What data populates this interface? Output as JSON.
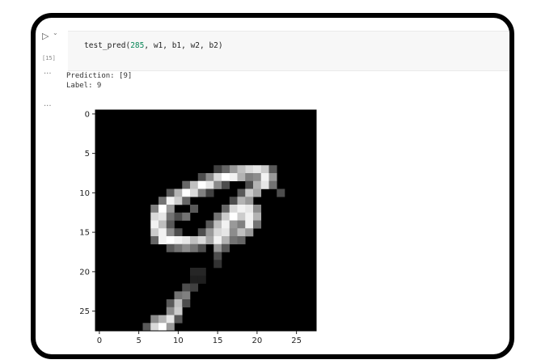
{
  "cell": {
    "run_icon": "▷",
    "caret_icon": "⌄",
    "execution_count": "[15]",
    "code_prefix": "test_pred(",
    "code_arg_number": "285",
    "code_suffix": ", w1, b1, w2, b2)"
  },
  "output": {
    "more_icon_1": "···",
    "prediction_line": "Prediction:  [9]",
    "label_line": "Label:  9",
    "more_icon_2": "···"
  },
  "chart_data": {
    "type": "heatmap",
    "title": "",
    "xlabel": "",
    "ylabel": "",
    "xticks": [
      "0",
      "5",
      "10",
      "15",
      "20",
      "25"
    ],
    "yticks": [
      "0",
      "5",
      "10",
      "15",
      "20",
      "25"
    ],
    "xlim": [
      -0.5,
      27.5
    ],
    "ylim": [
      27.5,
      -0.5
    ],
    "colormap": "gray",
    "grid": false,
    "pixels": [
      {
        "r": 7,
        "c": 19,
        "v": 0.85
      },
      {
        "r": 7,
        "c": 20,
        "v": 0.9
      },
      {
        "r": 7,
        "c": 21,
        "v": 0.8
      },
      {
        "r": 7,
        "c": 17,
        "v": 0.6
      },
      {
        "r": 7,
        "c": 18,
        "v": 0.75
      },
      {
        "r": 7,
        "c": 16,
        "v": 0.4
      },
      {
        "r": 7,
        "c": 15,
        "v": 0.25
      },
      {
        "r": 7,
        "c": 22,
        "v": 0.35
      },
      {
        "r": 8,
        "c": 13,
        "v": 0.3
      },
      {
        "r": 8,
        "c": 14,
        "v": 0.55
      },
      {
        "r": 8,
        "c": 15,
        "v": 0.85
      },
      {
        "r": 8,
        "c": 16,
        "v": 1.0
      },
      {
        "r": 8,
        "c": 17,
        "v": 0.95
      },
      {
        "r": 8,
        "c": 18,
        "v": 0.7
      },
      {
        "r": 8,
        "c": 19,
        "v": 0.5
      },
      {
        "r": 8,
        "c": 20,
        "v": 0.55
      },
      {
        "r": 8,
        "c": 21,
        "v": 0.95
      },
      {
        "r": 8,
        "c": 22,
        "v": 0.6
      },
      {
        "r": 9,
        "c": 11,
        "v": 0.4
      },
      {
        "r": 9,
        "c": 12,
        "v": 0.75
      },
      {
        "r": 9,
        "c": 13,
        "v": 1.0
      },
      {
        "r": 9,
        "c": 14,
        "v": 0.9
      },
      {
        "r": 9,
        "c": 15,
        "v": 0.55
      },
      {
        "r": 9,
        "c": 16,
        "v": 0.3
      },
      {
        "r": 9,
        "c": 19,
        "v": 0.3
      },
      {
        "r": 9,
        "c": 20,
        "v": 0.7
      },
      {
        "r": 9,
        "c": 21,
        "v": 0.9
      },
      {
        "r": 9,
        "c": 22,
        "v": 0.45
      },
      {
        "r": 10,
        "c": 9,
        "v": 0.35
      },
      {
        "r": 10,
        "c": 10,
        "v": 0.7
      },
      {
        "r": 10,
        "c": 11,
        "v": 1.0
      },
      {
        "r": 10,
        "c": 12,
        "v": 0.85
      },
      {
        "r": 10,
        "c": 13,
        "v": 0.5
      },
      {
        "r": 10,
        "c": 14,
        "v": 0.25
      },
      {
        "r": 10,
        "c": 18,
        "v": 0.35
      },
      {
        "r": 10,
        "c": 19,
        "v": 0.8
      },
      {
        "r": 10,
        "c": 20,
        "v": 0.65
      },
      {
        "r": 10,
        "c": 23,
        "v": 0.3
      },
      {
        "r": 11,
        "c": 8,
        "v": 0.45
      },
      {
        "r": 11,
        "c": 9,
        "v": 0.95
      },
      {
        "r": 11,
        "c": 10,
        "v": 0.8
      },
      {
        "r": 11,
        "c": 11,
        "v": 0.4
      },
      {
        "r": 11,
        "c": 17,
        "v": 0.3
      },
      {
        "r": 11,
        "c": 18,
        "v": 0.7
      },
      {
        "r": 11,
        "c": 19,
        "v": 0.6
      },
      {
        "r": 12,
        "c": 7,
        "v": 0.5
      },
      {
        "r": 12,
        "c": 8,
        "v": 1.0
      },
      {
        "r": 12,
        "c": 9,
        "v": 0.6
      },
      {
        "r": 12,
        "c": 12,
        "v": 0.35
      },
      {
        "r": 12,
        "c": 16,
        "v": 0.4
      },
      {
        "r": 12,
        "c": 17,
        "v": 0.85
      },
      {
        "r": 12,
        "c": 18,
        "v": 0.95
      },
      {
        "r": 12,
        "c": 19,
        "v": 0.9
      },
      {
        "r": 12,
        "c": 20,
        "v": 0.55
      },
      {
        "r": 13,
        "c": 7,
        "v": 0.85
      },
      {
        "r": 13,
        "c": 8,
        "v": 0.9
      },
      {
        "r": 13,
        "c": 9,
        "v": 0.45
      },
      {
        "r": 13,
        "c": 10,
        "v": 0.3
      },
      {
        "r": 13,
        "c": 11,
        "v": 0.45
      },
      {
        "r": 13,
        "c": 15,
        "v": 0.45
      },
      {
        "r": 13,
        "c": 16,
        "v": 0.8
      },
      {
        "r": 13,
        "c": 17,
        "v": 1.0
      },
      {
        "r": 13,
        "c": 18,
        "v": 0.8
      },
      {
        "r": 13,
        "c": 19,
        "v": 0.95
      },
      {
        "r": 13,
        "c": 20,
        "v": 0.7
      },
      {
        "r": 14,
        "c": 7,
        "v": 0.95
      },
      {
        "r": 14,
        "c": 8,
        "v": 0.75
      },
      {
        "r": 14,
        "c": 9,
        "v": 0.35
      },
      {
        "r": 14,
        "c": 14,
        "v": 0.35
      },
      {
        "r": 14,
        "c": 15,
        "v": 0.75
      },
      {
        "r": 14,
        "c": 16,
        "v": 0.95
      },
      {
        "r": 14,
        "c": 17,
        "v": 0.6
      },
      {
        "r": 14,
        "c": 18,
        "v": 0.5
      },
      {
        "r": 14,
        "c": 19,
        "v": 0.95
      },
      {
        "r": 14,
        "c": 20,
        "v": 0.45
      },
      {
        "r": 15,
        "c": 7,
        "v": 0.8
      },
      {
        "r": 15,
        "c": 8,
        "v": 0.95
      },
      {
        "r": 15,
        "c": 9,
        "v": 0.55
      },
      {
        "r": 15,
        "c": 10,
        "v": 0.3
      },
      {
        "r": 15,
        "c": 13,
        "v": 0.3
      },
      {
        "r": 15,
        "c": 14,
        "v": 0.6
      },
      {
        "r": 15,
        "c": 15,
        "v": 0.85
      },
      {
        "r": 15,
        "c": 16,
        "v": 0.9
      },
      {
        "r": 15,
        "c": 17,
        "v": 0.55
      },
      {
        "r": 15,
        "c": 18,
        "v": 0.75
      },
      {
        "r": 15,
        "c": 19,
        "v": 0.6
      },
      {
        "r": 16,
        "c": 7,
        "v": 0.4
      },
      {
        "r": 16,
        "c": 8,
        "v": 0.95
      },
      {
        "r": 16,
        "c": 9,
        "v": 1.0
      },
      {
        "r": 16,
        "c": 10,
        "v": 0.95
      },
      {
        "r": 16,
        "c": 11,
        "v": 0.9
      },
      {
        "r": 16,
        "c": 12,
        "v": 0.75
      },
      {
        "r": 16,
        "c": 13,
        "v": 0.85
      },
      {
        "r": 16,
        "c": 14,
        "v": 0.65
      },
      {
        "r": 16,
        "c": 15,
        "v": 0.95
      },
      {
        "r": 16,
        "c": 16,
        "v": 0.7
      },
      {
        "r": 16,
        "c": 17,
        "v": 0.45
      },
      {
        "r": 16,
        "c": 18,
        "v": 0.4
      },
      {
        "r": 17,
        "c": 9,
        "v": 0.35
      },
      {
        "r": 17,
        "c": 10,
        "v": 0.45
      },
      {
        "r": 17,
        "c": 11,
        "v": 0.55
      },
      {
        "r": 17,
        "c": 12,
        "v": 0.45
      },
      {
        "r": 17,
        "c": 13,
        "v": 0.3
      },
      {
        "r": 17,
        "c": 15,
        "v": 0.6
      },
      {
        "r": 17,
        "c": 16,
        "v": 0.35
      },
      {
        "r": 18,
        "c": 15,
        "v": 0.3
      },
      {
        "r": 19,
        "c": 15,
        "v": 0.2
      },
      {
        "r": 20,
        "c": 12,
        "v": 0.15
      },
      {
        "r": 20,
        "c": 13,
        "v": 0.15
      },
      {
        "r": 21,
        "c": 12,
        "v": 0.12
      },
      {
        "r": 21,
        "c": 13,
        "v": 0.12
      },
      {
        "r": 22,
        "c": 11,
        "v": 0.3
      },
      {
        "r": 22,
        "c": 12,
        "v": 0.25
      },
      {
        "r": 23,
        "c": 10,
        "v": 0.45
      },
      {
        "r": 23,
        "c": 11,
        "v": 0.5
      },
      {
        "r": 24,
        "c": 9,
        "v": 0.35
      },
      {
        "r": 24,
        "c": 10,
        "v": 0.75
      },
      {
        "r": 24,
        "c": 11,
        "v": 0.3
      },
      {
        "r": 25,
        "c": 9,
        "v": 0.55
      },
      {
        "r": 25,
        "c": 10,
        "v": 0.8
      },
      {
        "r": 26,
        "c": 7,
        "v": 0.55
      },
      {
        "r": 26,
        "c": 8,
        "v": 0.7
      },
      {
        "r": 26,
        "c": 9,
        "v": 0.9
      },
      {
        "r": 26,
        "c": 10,
        "v": 0.35
      },
      {
        "r": 27,
        "c": 6,
        "v": 0.35
      },
      {
        "r": 27,
        "c": 7,
        "v": 0.85
      },
      {
        "r": 27,
        "c": 8,
        "v": 1.0
      },
      {
        "r": 27,
        "c": 9,
        "v": 0.6
      }
    ]
  }
}
